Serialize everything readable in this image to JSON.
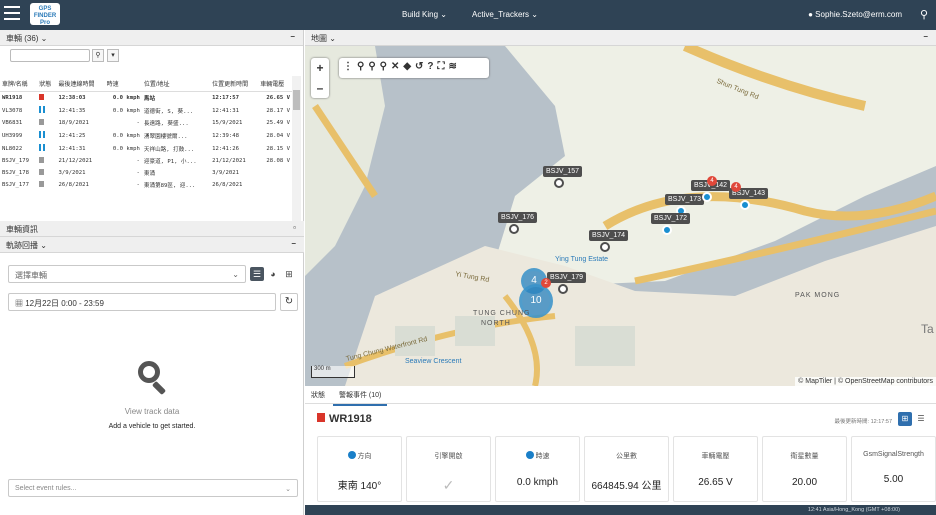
{
  "header": {
    "logo_line1": "GPS",
    "logo_line2": "FINDER",
    "logo_line3": "Pro",
    "company": "Build King",
    "group": "Active_Trackers",
    "user_email": "Sophie.Szeto@erm.com"
  },
  "vehicles": {
    "title": "車輛 (36)",
    "columns": [
      "車牌/名稱",
      "狀態",
      "最後連線時間",
      "時速",
      "位置/地址",
      "位置更新時間",
      "車輛電壓"
    ],
    "rows": [
      {
        "plate": "WR1918",
        "status": "red",
        "last": "12:38:03",
        "speed": "0.0 kmph",
        "addr": "馬站",
        "upd": "12:17:57",
        "volt": "26.65 V"
      },
      {
        "plate": "VL3078",
        "status": "bars",
        "last": "12:41:35",
        "speed": "0.0 kmph",
        "addr": "道德街, S, 葵...",
        "upd": "12:41:31",
        "volt": "28.17 V"
      },
      {
        "plate": "VB6831",
        "status": "gray",
        "last": "18/9/2021",
        "speed": "-",
        "addr": "長遠路, 葵盛...",
        "upd": "15/9/2021",
        "volt": "25.49 V"
      },
      {
        "plate": "UH3999",
        "status": "bars",
        "last": "12:41:25",
        "speed": "0.0 kmph",
        "addr": "湧翠園樓號爾...",
        "upd": "12:39:48",
        "volt": "28.04 V"
      },
      {
        "plate": "NL8022",
        "status": "bars",
        "last": "12:41:31",
        "speed": "0.0 kmph",
        "addr": "天祥山路, 打鼓...",
        "upd": "12:41:26",
        "volt": "28.15 V"
      },
      {
        "plate": "BSJV_179",
        "status": "gray",
        "last": "21/12/2021",
        "speed": "-",
        "addr": "迎豪道, P1, 小...",
        "upd": "21/12/2021",
        "volt": "28.08 V"
      },
      {
        "plate": "BSJV_178",
        "status": "gray",
        "last": "3/9/2021",
        "speed": "-",
        "addr": "東涌",
        "upd": "3/9/2021",
        "volt": ""
      },
      {
        "plate": "BSJV_177",
        "status": "gray",
        "last": "26/8/2021",
        "speed": "-",
        "addr": "東涌第89區, 迎...",
        "upd": "26/8/2021",
        "volt": ""
      }
    ]
  },
  "info_panel_title": "車輛資訊",
  "track": {
    "title": "軌跡回播",
    "select_placeholder": "選擇車輛",
    "date_range": "12月22日 0:00 - 23:59",
    "empty_title": "View track data",
    "empty_sub": "Add a vehicle to get started.",
    "event_placeholder": "Select event rules..."
  },
  "map": {
    "title": "地圖",
    "pins": [
      "BSJV_157",
      "BSJV_176",
      "BSJV_173",
      "BSJV_142",
      "BSJV_143",
      "BSJV_172",
      "BSJV_174",
      "BSJV_179"
    ],
    "clusters": [
      "4",
      "10",
      "3"
    ],
    "badges": [
      "4",
      "4",
      "2"
    ],
    "labels": [
      "TUNG CHUNG",
      "NORTH",
      "PAK MONG",
      "Tung Chung Waterfront Rd",
      "Shun Tung Rd",
      "Seaview Crescent",
      "Ying Tung Estate",
      "Yi Tung Rd"
    ],
    "scale": "300 m",
    "attribution": "© MapTiler | © OpenStreetMap contributors",
    "edge_text": "Ta"
  },
  "detail": {
    "tabs": [
      "狀態",
      "警報事件 (10)"
    ],
    "vehicle": "WR1918",
    "updated": "最後更新時間: 12:17:57",
    "cards": [
      {
        "label": "方向",
        "value": "東南 140°"
      },
      {
        "label": "引擎開啟",
        "value": "✓"
      },
      {
        "label": "時速",
        "value": "0.0 kmph"
      },
      {
        "label": "公里數",
        "value": "664845.94 公里"
      },
      {
        "label": "車輛電壓",
        "value": "26.65 V"
      },
      {
        "label": "衛星數量",
        "value": "20.00"
      },
      {
        "label": "GsmSignalStrength",
        "value": "5.00"
      }
    ]
  },
  "footer": "12:41 Asia/Hong_Kong (GMT +08:00)"
}
